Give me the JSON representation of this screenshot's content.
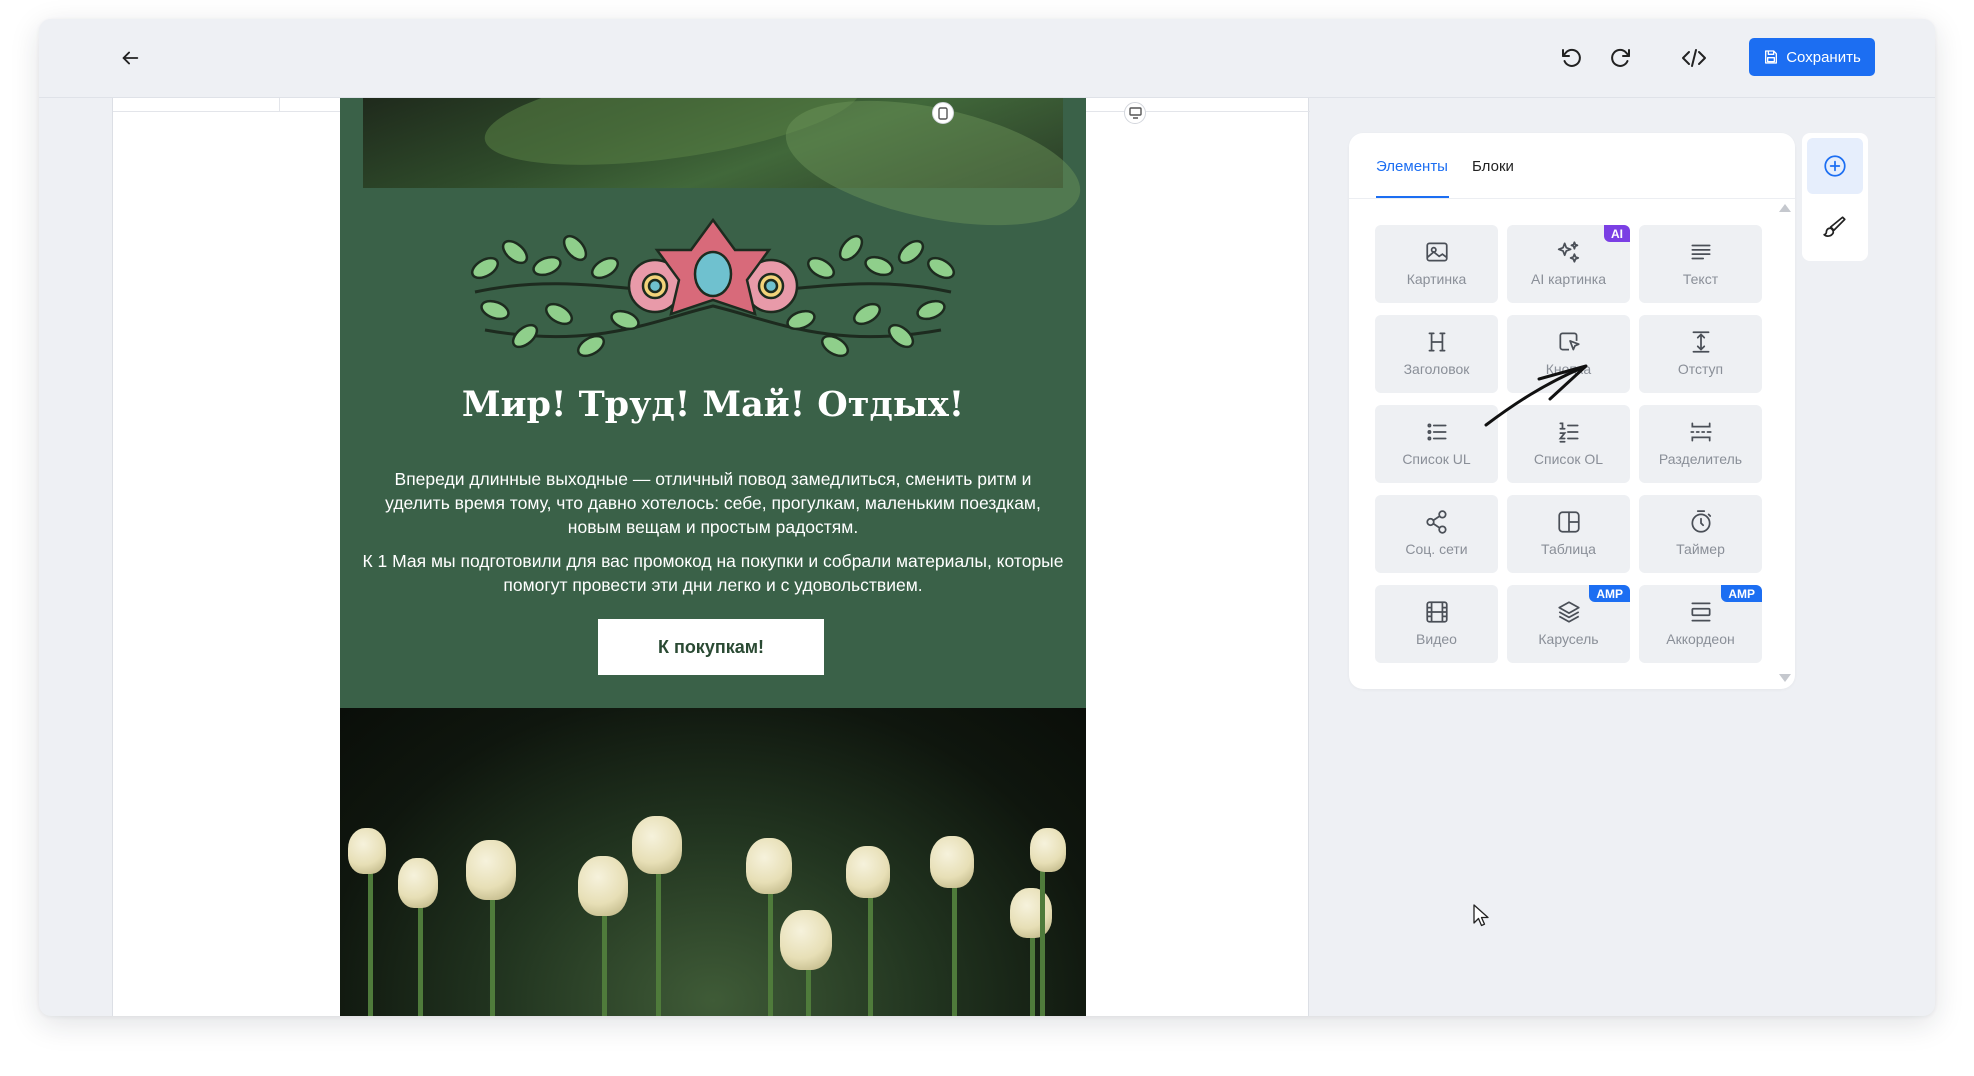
{
  "toolbar": {
    "save_label": "Сохранить",
    "icons": [
      "arrow-left-icon",
      "undo-icon",
      "redo-icon",
      "code-icon",
      "save-icon"
    ]
  },
  "email": {
    "headline": "Мир! Труд! Май! Отдых!",
    "paragraph1": "Впереди длинные выходные — отличный повод замедлиться, сменить ритм и уделить время тому, что давно хотелось: себе, прогулкам, маленьким поездкам, новым вещам и простым радостям.",
    "paragraph2": "К 1 Мая мы подготовили для вас промокод на покупки и собрали материалы, которые помогут провести эти дни легко и с удовольствием.",
    "cta_label": "К покупкам!",
    "background_color": "#3a6148"
  },
  "panel": {
    "tabs": [
      {
        "label": "Элементы",
        "active": true
      },
      {
        "label": "Блоки",
        "active": false
      }
    ],
    "tiles": [
      {
        "label": "Картинка",
        "icon": "image-icon",
        "badge": ""
      },
      {
        "label": "AI картинка",
        "icon": "sparkles-icon",
        "badge": "AI"
      },
      {
        "label": "Текст",
        "icon": "text-icon",
        "badge": ""
      },
      {
        "label": "Заголовок",
        "icon": "heading-icon",
        "badge": ""
      },
      {
        "label": "Кнопка",
        "icon": "button-cursor-icon",
        "badge": ""
      },
      {
        "label": "Отступ",
        "icon": "spacer-icon",
        "badge": ""
      },
      {
        "label": "Список UL",
        "icon": "list-ul-icon",
        "badge": ""
      },
      {
        "label": "Список OL",
        "icon": "list-ol-icon",
        "badge": ""
      },
      {
        "label": "Разделитель",
        "icon": "divider-icon",
        "badge": ""
      },
      {
        "label": "Соц. сети",
        "icon": "share-icon",
        "badge": ""
      },
      {
        "label": "Таблица",
        "icon": "table-icon",
        "badge": ""
      },
      {
        "label": "Таймер",
        "icon": "timer-icon",
        "badge": ""
      },
      {
        "label": "Видео",
        "icon": "video-icon",
        "badge": ""
      },
      {
        "label": "Карусель",
        "icon": "layers-icon",
        "badge": "AMP"
      },
      {
        "label": "Аккордеон",
        "icon": "accordion-icon",
        "badge": "AMP"
      }
    ]
  },
  "colors": {
    "accent": "#1c6ef2",
    "ai_badge": "#7b3fe4",
    "amp_badge": "#1c6ef2"
  }
}
